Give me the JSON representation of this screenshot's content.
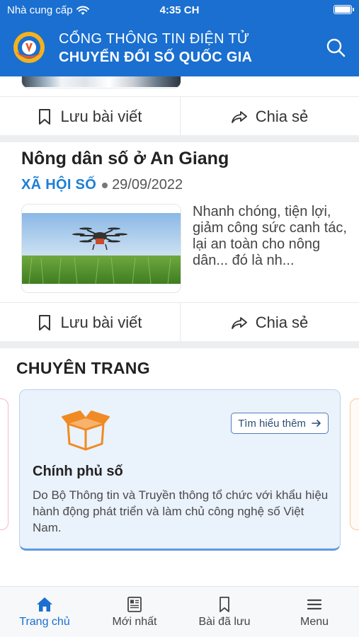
{
  "status_bar": {
    "carrier": "Nhà cung cấp",
    "time": "4:35 CH"
  },
  "header": {
    "title_line1": "CỔNG THÔNG TIN ĐIỆN TỬ",
    "title_line2": "CHUYỂN ĐỔI SỐ QUỐC GIA",
    "logo_icon": "national-digital-transformation-logo",
    "search_icon": "search-icon"
  },
  "articles": [
    {
      "actions": {
        "save_label": "Lưu bài viết",
        "share_label": "Chia sẻ"
      }
    },
    {
      "title": "Nông dân số ở An Giang",
      "category": "XÃ HỘI SỐ",
      "date": "29/09/2022",
      "excerpt": "Nhanh chóng, tiện lợi, giảm công sức canh tác, lại an toàn cho nông dân... đó là nh...",
      "thumbnail_icon": "agricultural-drone-image",
      "actions": {
        "save_label": "Lưu bài viết",
        "share_label": "Chia sẻ"
      }
    }
  ],
  "special_section": {
    "title": "CHUYÊN TRANG",
    "cards": [
      {
        "title": "Chính phủ số",
        "description": "Do Bộ Thông tin và Truyền thông tổ chức với khẩu hiệu hành động phát triển và làm chủ công nghệ số Việt Nam.",
        "button_label": "Tìm hiểu thêm",
        "icon": "open-box-icon"
      }
    ]
  },
  "bottom_nav": {
    "items": [
      {
        "label": "Trang chủ",
        "icon": "home-icon",
        "active": true
      },
      {
        "label": "Mới nhất",
        "icon": "newspaper-icon",
        "active": false
      },
      {
        "label": "Bài đã lưu",
        "icon": "bookmark-icon",
        "active": false
      },
      {
        "label": "Menu",
        "icon": "hamburger-icon",
        "active": false
      }
    ]
  },
  "colors": {
    "header_bg": "#1a6fd0",
    "category": "#1a7fd6",
    "active_tab": "#1a6fd0",
    "card_bg": "#eaf2fc",
    "box_orange": "#f08a24"
  }
}
